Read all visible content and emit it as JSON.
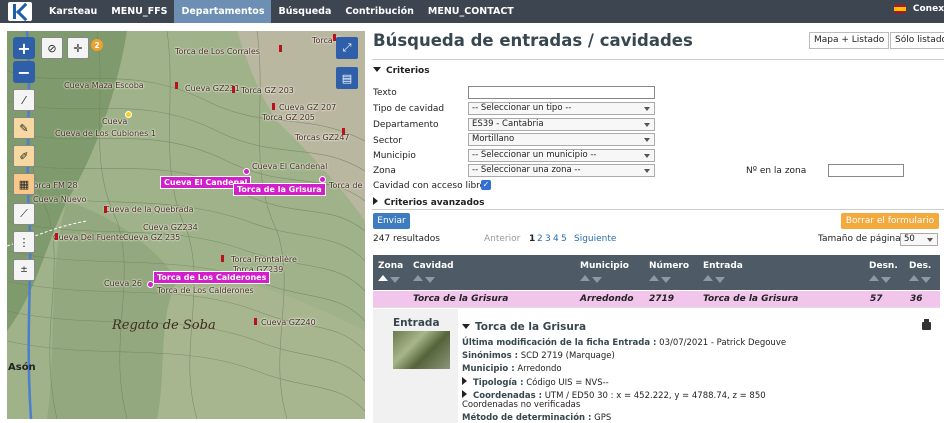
{
  "nav": {
    "items": [
      "Karsteau",
      "MENU_FFS",
      "Departamentos",
      "Búsqueda",
      "Contribución",
      "MENU_CONTACT"
    ],
    "active": "Departamentos",
    "right_label": "Conex"
  },
  "map": {
    "controls": {
      "zoom_in": "+",
      "zoom_out": "−",
      "badge": "2"
    },
    "labels": [
      "Torca de Los Corrales",
      "Torca G",
      "Cueva Maza Escoba",
      "Cueva GZ231",
      "Torca GZ 203",
      "Cueva GZ 207",
      "Torca GZ 205",
      "Torcas GZ247",
      "Cueva",
      "Cueva de Los Cubiones 1",
      "Cueva El Candenal",
      "Torca de",
      "Torca FM 28",
      "Cueva Nuevo",
      "Cueva de la Quebrada",
      "Cueva Del Fuente",
      "Cueva GZ 235",
      "Cueva GZ234",
      "Torca Frontalière",
      "Torca GZ239",
      "Cueva 26",
      "Torca de Los Calderones",
      "Cueva GZ240",
      "Regato de Soba",
      "Asón"
    ],
    "highlighted": [
      "Cueva El Candenal",
      "Torca de la Grisura",
      "Torca de Los Calderones"
    ]
  },
  "page": {
    "title": "Búsqueda de entradas / cavidades",
    "view_map_list": "Mapa + Listado",
    "view_list_only": "Sólo listado"
  },
  "criteria": {
    "heading": "Criterios",
    "fields": {
      "texto": {
        "label": "Texto",
        "value": ""
      },
      "tipo": {
        "label": "Tipo de cavidad",
        "value": "-- Seleccionar un tipo --"
      },
      "departamento": {
        "label": "Departamento",
        "value": "ES39 - Cantabria"
      },
      "sector": {
        "label": "Sector",
        "value": "Mortillano"
      },
      "municipio": {
        "label": "Municipio",
        "value": "-- Seleccionar un municipio --"
      },
      "zona": {
        "label": "Zona",
        "value": "-- Seleccionar una zona --"
      },
      "num_zona": {
        "label": "Nº en la zona",
        "value": ""
      },
      "acceso": {
        "label": "Cavidad con acceso libre",
        "checked": "✓"
      }
    },
    "advanced": "Criterios avanzados",
    "submit": "Enviar",
    "reset": "Borrar el formulario"
  },
  "results": {
    "count": "247 resultados",
    "prev": "Anterior",
    "pages": [
      "1",
      "2",
      "3",
      "4",
      "5"
    ],
    "next": "Siguiente",
    "page_size_label": "Tamaño de página :",
    "page_size": "50",
    "columns": [
      "Zona",
      "Cavidad",
      "Municipio",
      "Número",
      "Entrada",
      "Desn.",
      "Des."
    ],
    "rows": [
      {
        "zona": "",
        "cavidad": "Torca de la Grisura",
        "municipio": "Arredondo",
        "numero": "2719",
        "entrada": "Torca de la Grisura",
        "desn": "57",
        "des": "36"
      }
    ]
  },
  "detail": {
    "section": "Entrada",
    "name": "Torca de la Grisura",
    "lines": {
      "mod_label": "Última modificación de la ficha Entrada :",
      "mod_value": "03/07/2021 - Patrick Degouve",
      "syn_label": "Sinónimos :",
      "syn_value": "SCD 2719 (Marquage)",
      "mun_label": "Municipio :",
      "mun_value": "Arredondo",
      "tip_label": "Tipología :",
      "tip_value": "Código UIS = NVS--",
      "coord_label": "Coordenadas :",
      "coord_value": "UTM / ED50 30 : x = 452.222, y = 4788.74, z = 850",
      "coord_note": "Coordenadas no verificadas",
      "met_label": "Método de determinación :",
      "met_value": "GPS"
    }
  }
}
